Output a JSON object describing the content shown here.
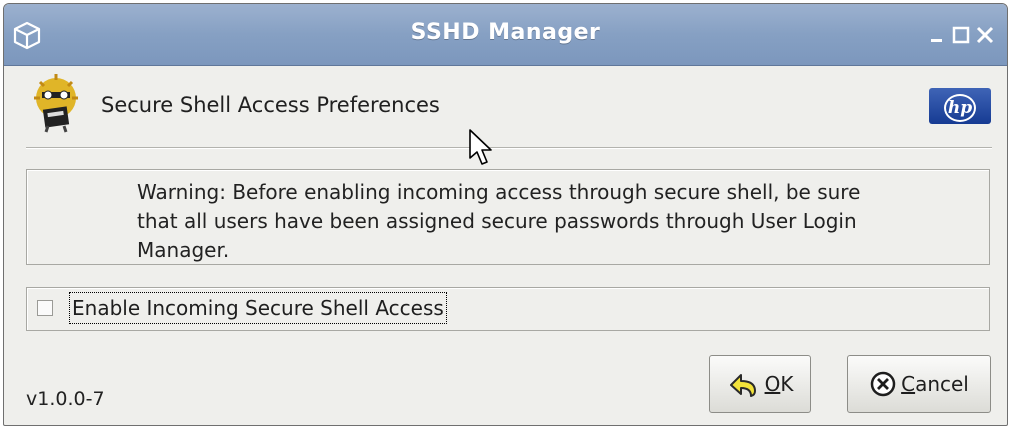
{
  "window": {
    "title": "SSHD Manager",
    "controls": {
      "minimize": "minimize-icon",
      "maximize": "maximize-icon",
      "close": "close-icon"
    }
  },
  "header": {
    "title": "Secure Shell Access Preferences",
    "app_icon": "sshd-mascot-icon",
    "brand_logo": "hp"
  },
  "warning": {
    "text": "Warning:  Before enabling incoming access through secure shell, be sure that all users have been assigned secure passwords through User Login Manager."
  },
  "option": {
    "label": "Enable Incoming Secure Shell Access",
    "checked": false
  },
  "footer": {
    "version": "v1.0.0-7",
    "ok": {
      "mnemonic": "O",
      "rest": "K"
    },
    "cancel": {
      "mnemonic": "C",
      "rest": "ancel"
    }
  },
  "colors": {
    "titlebar": "#86a0c3",
    "window_bg": "#efefec",
    "hp_blue": "#1f4aa3"
  }
}
